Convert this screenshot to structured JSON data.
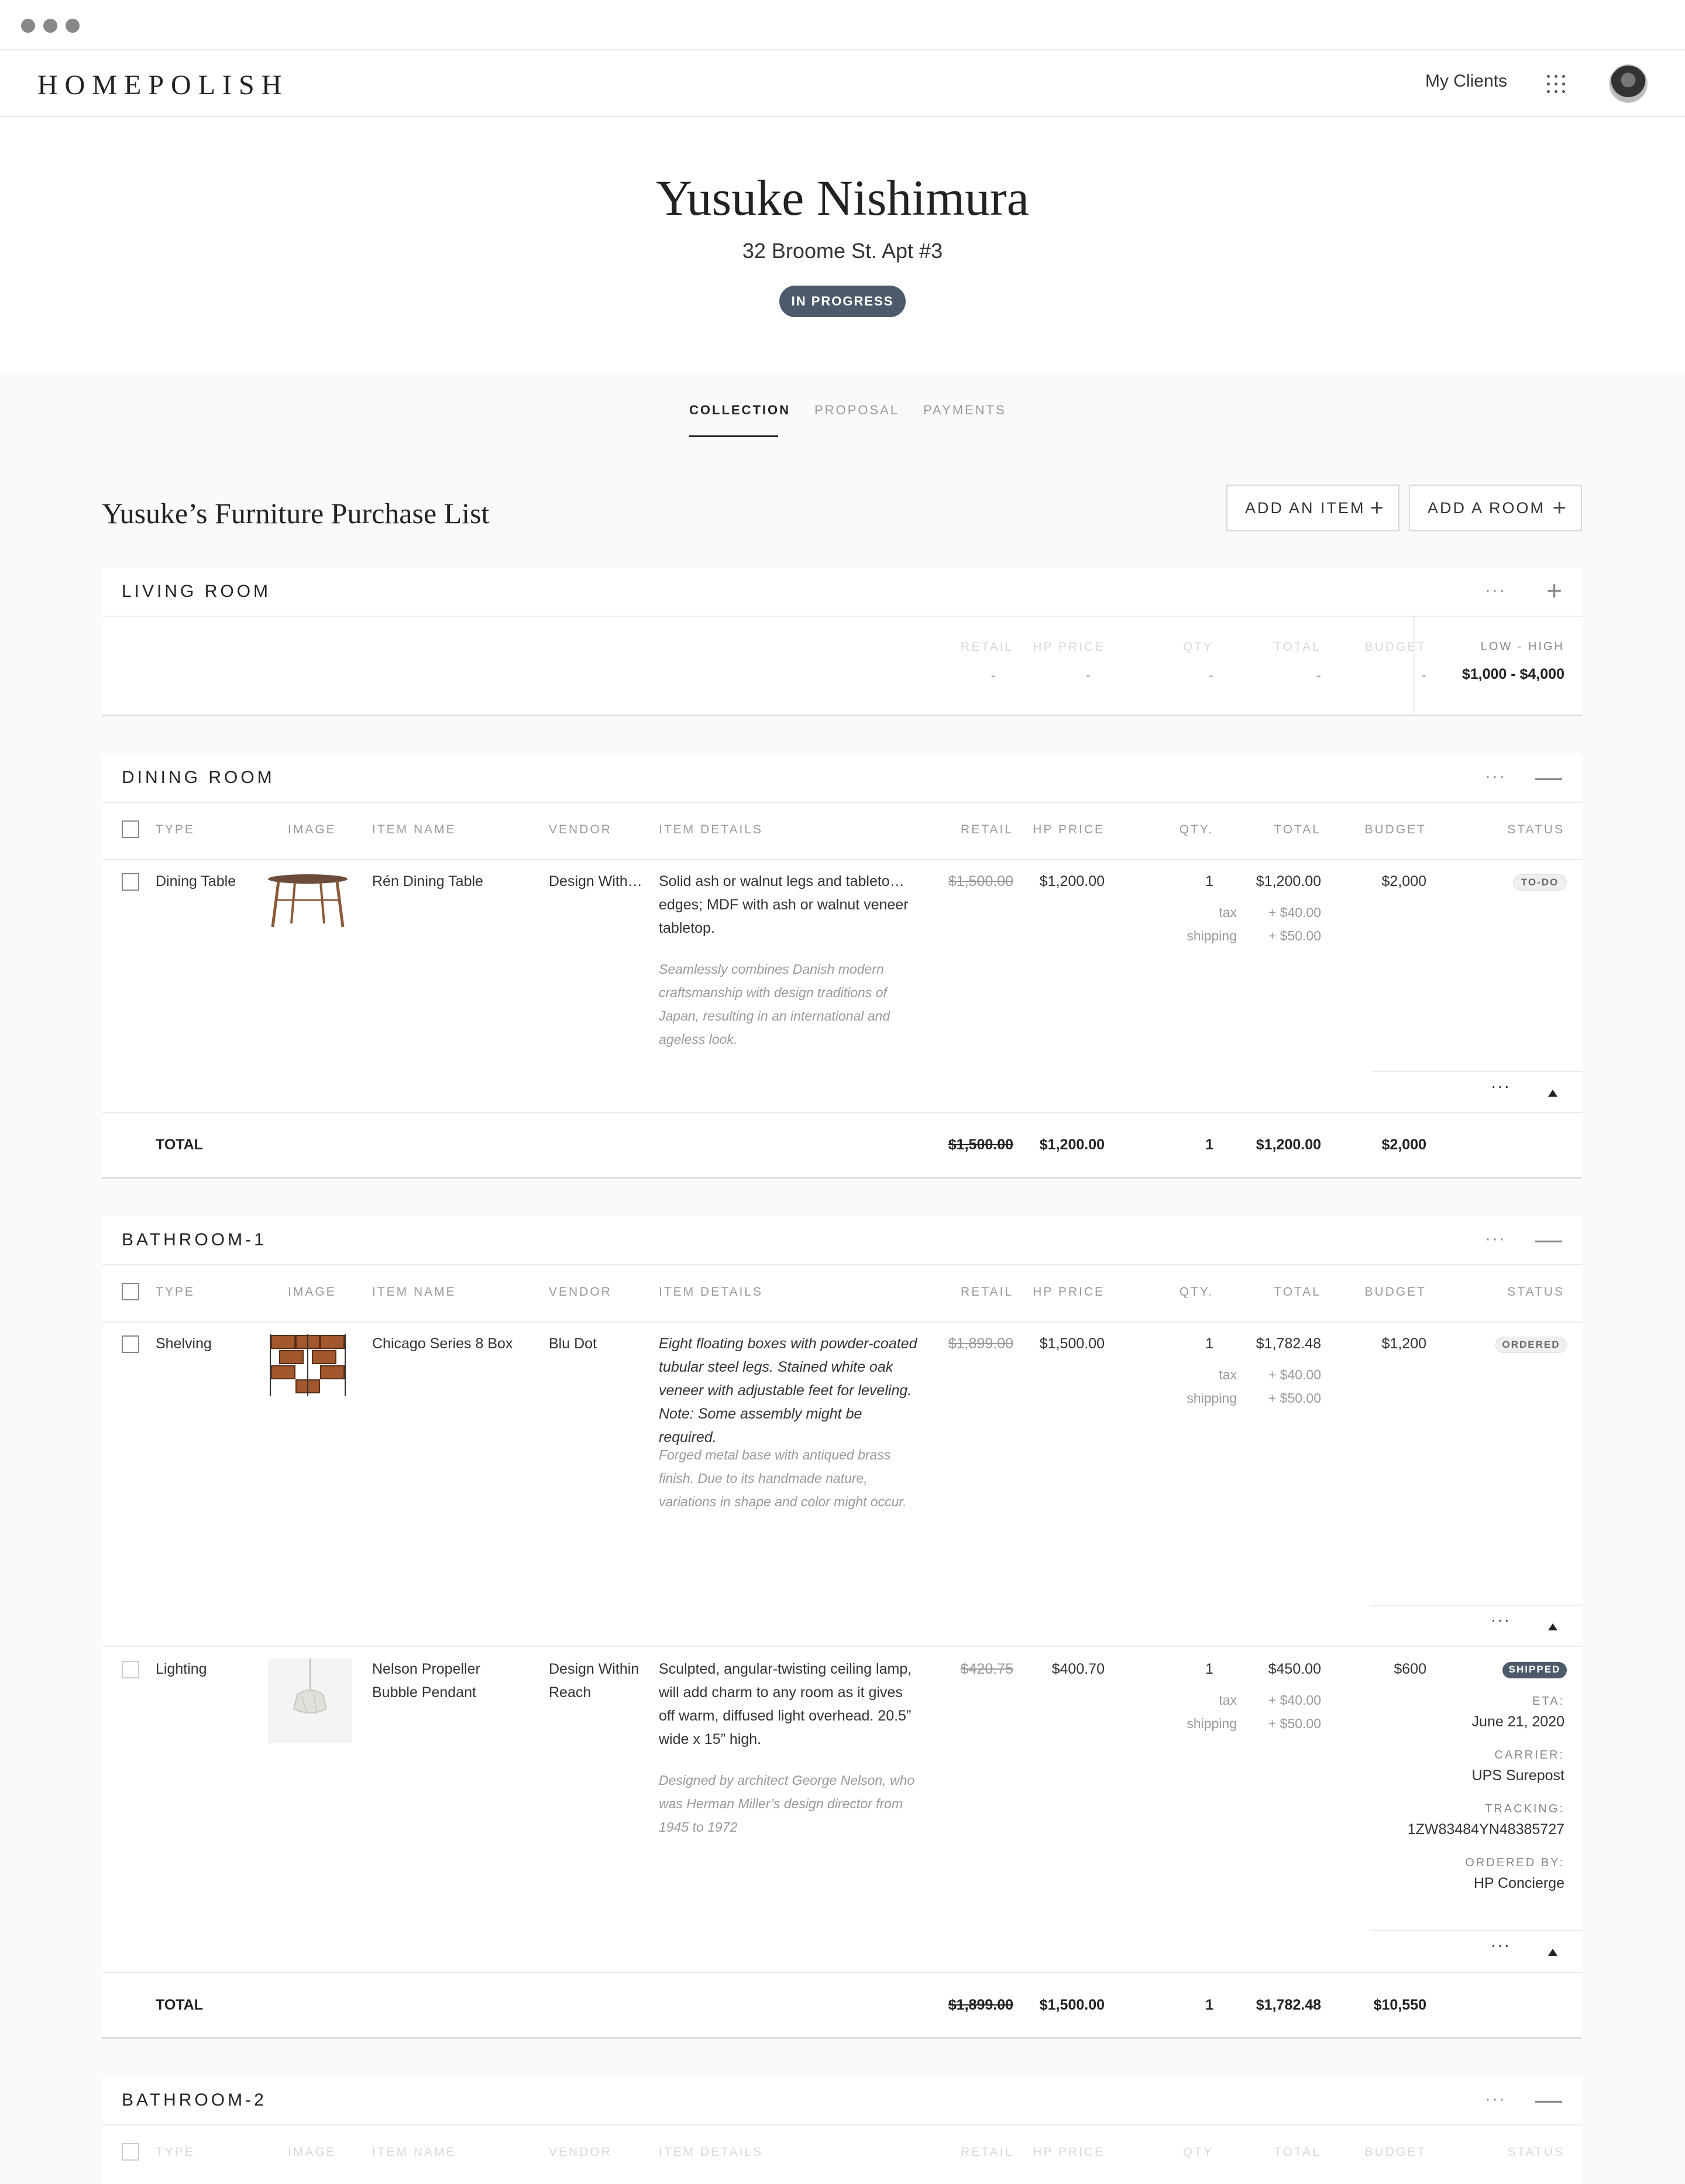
{
  "nav": {
    "logo": "HOMEPOLISH",
    "my_clients": "My Clients"
  },
  "client": {
    "name": "Yusuke Nishimura",
    "address": "32 Broome St. Apt #3",
    "status": "IN PROGRESS"
  },
  "tabs": [
    {
      "label": "COLLECTION",
      "active": true
    },
    {
      "label": "PROPOSAL",
      "active": false
    },
    {
      "label": "PAYMENTS",
      "active": false
    }
  ],
  "list": {
    "title": "Yusuke’s Furniture Purchase List",
    "add_item": "ADD AN ITEM",
    "add_room": "ADD A ROOM"
  },
  "columns": {
    "type": "TYPE",
    "image": "IMAGE",
    "item_name": "ITEM NAME",
    "vendor": "VENDOR",
    "item_details": "ITEM DETAILS",
    "retail": "RETAIL",
    "hp_price": "HP PRICE",
    "qty": "QTY.",
    "qty_short": "QTY",
    "total": "TOTAL",
    "budget": "BUDGET",
    "status": "STATUS"
  },
  "living_room": {
    "name": "LIVING ROOM",
    "dash": "-",
    "budget_label": "LOW - HIGH",
    "budget_value": "$1,000 - $4,000"
  },
  "dining_room": {
    "name": "DINING ROOM",
    "items": [
      {
        "type": "Dining Table",
        "name": "Rén Dining Table",
        "vendor": "Design With…",
        "details": "Solid ash or walnut legs and tableto… edges; MDF with ash or walnut veneer tabletop.",
        "note": "Seamlessly combines Danish modern craftsmanship with design traditions of Japan, resulting in an international and ageless look.",
        "retail": "$1,500.00",
        "hp_price": "$1,200.00",
        "qty": "1",
        "total": "$1,200.00",
        "tax_label": "tax",
        "tax": "+ $40.00",
        "shipping_label": "shipping",
        "shipping": "+ $50.00",
        "budget": "$2,000",
        "status": "TO-DO"
      }
    ],
    "total": {
      "label": "TOTAL",
      "retail": "$1,500.00",
      "hp_price": "$1,200.00",
      "qty": "1",
      "total": "$1,200.00",
      "budget": "$2,000"
    }
  },
  "bathroom1": {
    "name": "BATHROOM-1",
    "items": [
      {
        "type": "Shelving",
        "name": "Chicago Series 8 Box",
        "vendor": "Blu Dot",
        "details": "Eight floating boxes with powder-coated tubular steel legs. Stained white oak veneer with adjustable feet for leveling. Note: Some assembly might be required.",
        "note": "Forged metal base with antiqued brass finish. Due to its handmade nature, variations in shape and color might occur.",
        "retail": "$1,899.00",
        "hp_price": "$1,500.00",
        "qty": "1",
        "total": "$1,782.48",
        "tax_label": "tax",
        "tax": "+ $40.00",
        "shipping_label": "shipping",
        "shipping": "+ $50.00",
        "budget": "$1,200",
        "status": "ORDERED"
      },
      {
        "type": "Lighting",
        "name": "Nelson Propeller Bubble Pendant",
        "vendor": "Design Within Reach",
        "details": "Sculpted, angular-twisting ceiling lamp, will add charm to any room as it gives off warm, diffused light overhead. 20.5” wide x 15” high.",
        "note": "Designed by architect George Nelson, who was Herman Miller’s design director from 1945 to 1972",
        "retail": "$420.75",
        "hp_price": "$400.70",
        "qty": "1",
        "total": "$450.00",
        "tax_label": "tax",
        "tax": "+ $40.00",
        "shipping_label": "shipping",
        "shipping": "+ $50.00",
        "budget": "$600",
        "status": "SHIPPED",
        "eta_label": "ETA:",
        "eta": "June 21, 2020",
        "carrier_label": "CARRIER:",
        "carrier": "UPS Surepost",
        "tracking_label": "TRACKING:",
        "tracking": "1ZW83484YN48385727",
        "ordered_by_label": "ORDERED BY:",
        "ordered_by": "HP Concierge"
      }
    ],
    "total": {
      "label": "TOTAL",
      "retail": "$1,899.00",
      "hp_price": "$1,500.00",
      "qty": "1",
      "total": "$1,782.48",
      "budget": "$10,550"
    }
  },
  "bathroom2": {
    "name": "BATHROOM-2"
  }
}
